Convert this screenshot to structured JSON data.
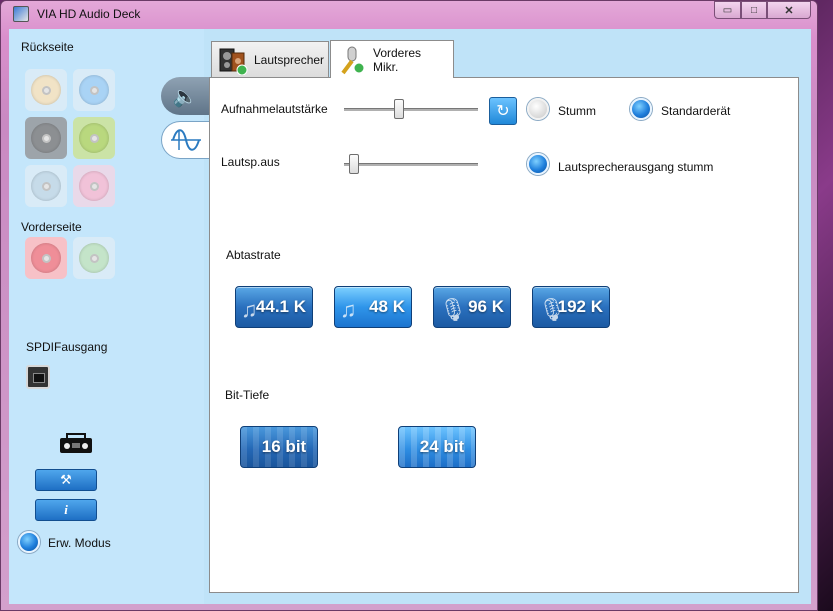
{
  "window": {
    "title": "VIA HD Audio Deck"
  },
  "window_controls": {
    "minimize": "▭",
    "maximize": "□",
    "close": "✕"
  },
  "sidebar": {
    "back_label": "Rückseite",
    "front_label": "Vorderseite",
    "spdif_label": "SPDIFausgang",
    "advanced_mode_label": "Erw. Modus",
    "back_jacks": [
      {
        "color": "#f1e3c6",
        "name": "jack-beige"
      },
      {
        "color": "#a9d3f5",
        "name": "jack-blue"
      },
      {
        "color": "#8c8f92",
        "name": "jack-grey"
      },
      {
        "color": "#b9d87e",
        "name": "jack-green"
      },
      {
        "color": "#c6dbe9",
        "name": "jack-lightblue"
      },
      {
        "color": "#f1c2d8",
        "name": "jack-pink"
      }
    ],
    "front_jacks": [
      {
        "color": "#ef8e98",
        "name": "jack-pink-front"
      },
      {
        "color": "#c4e4c9",
        "name": "jack-green-front"
      }
    ]
  },
  "tabs": [
    {
      "label": "Lautsprecher"
    },
    {
      "label": "Vorderes Mikr."
    }
  ],
  "controls": {
    "record_volume_label": "Aufnahmelautstärke",
    "mute_label": "Stumm",
    "default_device_label": "Standarderät",
    "speaker_off_label": "Lautsp.aus",
    "speaker_mute_label": "Lautsprecherausgang stumm",
    "record_volume_level": 0.4,
    "speaker_off_level": 0.04
  },
  "sample_rate": {
    "label": "Abtastrate",
    "options": [
      {
        "label": "44.1 K",
        "icon": "music-note-icon",
        "selected": false
      },
      {
        "label": "48 K",
        "icon": "music-note-icon",
        "selected": true
      },
      {
        "label": "96 K",
        "icon": "microphone-icon",
        "selected": false
      },
      {
        "label": "192 K",
        "icon": "microphone-icon",
        "selected": false
      }
    ]
  },
  "bit_depth": {
    "label": "Bit-Tiefe",
    "options": [
      {
        "label": "16 bit",
        "selected": false
      },
      {
        "label": "24 bit",
        "selected": true
      }
    ]
  }
}
